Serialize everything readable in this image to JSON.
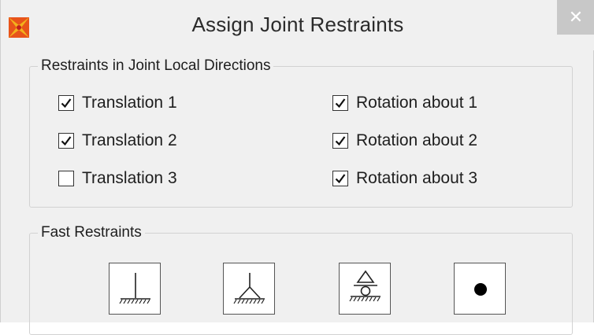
{
  "window": {
    "title": "Assign Joint Restraints",
    "close_glyph": "✕"
  },
  "local_directions": {
    "label": "Restraints in Joint Local Directions",
    "left": [
      {
        "label": "Translation 1",
        "checked": true
      },
      {
        "label": "Translation 2",
        "checked": true
      },
      {
        "label": "Translation 3",
        "checked": false
      }
    ],
    "right": [
      {
        "label": "Rotation about 1",
        "checked": true
      },
      {
        "label": "Rotation about 2",
        "checked": true
      },
      {
        "label": "Rotation about 3",
        "checked": true
      }
    ]
  },
  "fast_restraints": {
    "label": "Fast Restraints",
    "buttons": [
      {
        "icon": "fixed-support-icon"
      },
      {
        "icon": "pinned-support-icon"
      },
      {
        "icon": "roller-support-icon"
      },
      {
        "icon": "free-joint-icon"
      }
    ]
  },
  "colors": {
    "background": "#f0f0f0",
    "close_button": "#c8c8c8",
    "app_icon_orange": "#e8541a",
    "app_icon_yellow": "#f2b21c"
  }
}
